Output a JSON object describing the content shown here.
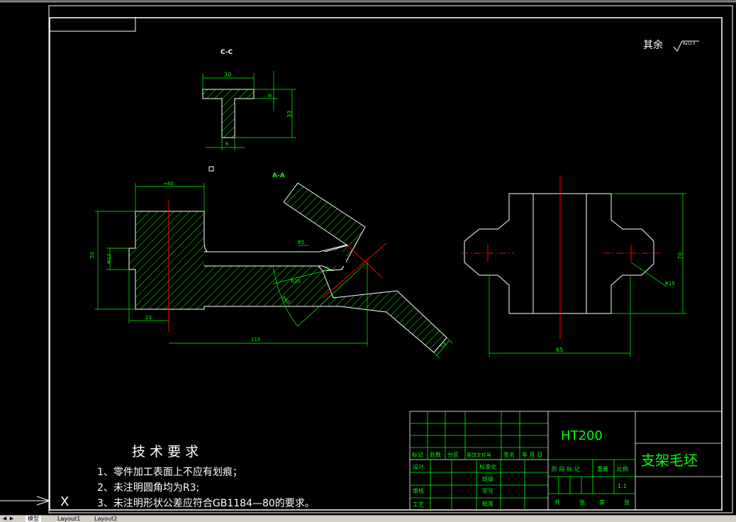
{
  "drawing": {
    "section_label": "C-C",
    "view_label": "A-A",
    "roughness_note": "其余",
    "roughness_value": "Ra12.5",
    "section_dims": {
      "top_width": "30",
      "flange": "8",
      "height": "33",
      "web": "6"
    },
    "front_dims": {
      "top": "≈40",
      "left_height": "55",
      "bore": "Φ12",
      "offset": "23",
      "length": "115",
      "r5": "R5",
      "r20": "R20",
      "r60": "R60",
      "thickness": "14"
    },
    "side_dims": {
      "height": "70",
      "width": "65",
      "r15": "R15"
    }
  },
  "tech": {
    "title": "技 术 要 求",
    "items": [
      "1、零件加工表面上不应有划痕；",
      "2、未注明圆角均为R3;",
      "3、未注明形状公差应符合GB1184—80的要求。"
    ]
  },
  "title_block": {
    "material": "HT200",
    "part_name": "支架毛坯",
    "headers": [
      "标记",
      "处数",
      "分区",
      "更改文件号",
      "签名",
      "年 月 日"
    ],
    "row_labels": [
      "设计",
      "审核",
      "工艺"
    ],
    "std_labels": [
      "标准化",
      "班级",
      "学号",
      "批准"
    ],
    "stage_headers": [
      "阶 段 标 记",
      "重量",
      "比例"
    ],
    "scale": "1:1",
    "sheet_text": [
      "共",
      "张",
      "第",
      "张"
    ]
  },
  "ucs": {
    "x_label": "X"
  },
  "tabs": {
    "model": "模型",
    "layout1": "Layout1",
    "layout2": "Layout2"
  },
  "colors": {
    "line": "#ffffff",
    "dim": "#00ff00",
    "center": "#ff0000",
    "bg": "#000000"
  }
}
